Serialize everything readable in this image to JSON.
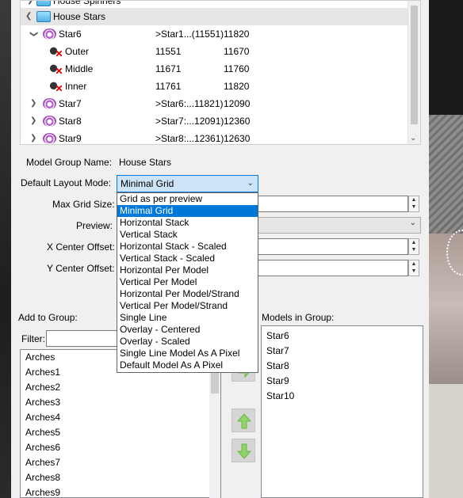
{
  "tree": {
    "rows": [
      {
        "label": "House Spinners",
        "start": "",
        "end": ""
      },
      {
        "label": "House Stars",
        "start": "",
        "end": ""
      },
      {
        "label": "Star6",
        "start": ">Star1...(11551)",
        "end": "11820"
      },
      {
        "label": "Outer",
        "start": "11551",
        "end": "11670"
      },
      {
        "label": "Middle",
        "start": "11671",
        "end": "11760"
      },
      {
        "label": "Inner",
        "start": "11761",
        "end": "11820"
      },
      {
        "label": "Star7",
        "start": ">Star6:...11821)",
        "end": "12090"
      },
      {
        "label": "Star8",
        "start": ">Star7:...12091)",
        "end": "12360"
      },
      {
        "label": "Star9",
        "start": ">Star8:...12361)",
        "end": "12630"
      }
    ]
  },
  "form": {
    "group_name_label": "Model Group Name:",
    "group_name_value": "House Stars",
    "layout_mode_label": "Default Layout Mode:",
    "layout_mode_value": "Minimal Grid",
    "max_grid_label": "Max Grid Size:",
    "preview_label": "Preview:",
    "x_offset_label": "X Center Offset:",
    "y_offset_label": "Y Center Offset:"
  },
  "layout_options": [
    "Grid as per preview",
    "Minimal Grid",
    "Horizontal Stack",
    "Vertical Stack",
    "Horizontal Stack - Scaled",
    "Vertical Stack - Scaled",
    "Horizontal Per Model",
    "Vertical Per Model",
    "Horizontal Per Model/Strand",
    "Vertical Per Model/Strand",
    "Single Line",
    "Overlay - Centered",
    "Overlay - Scaled",
    "Single Line Model As A Pixel",
    "Default Model As A Pixel"
  ],
  "highlighted_option": "Minimal Grid",
  "add_to_group": {
    "label": "Add to Group:",
    "filter_label": "Filter:",
    "items": [
      "Arches",
      "Arches1",
      "Arches2",
      "Arches3",
      "Arches4",
      "Arches5",
      "Arches6",
      "Arches7",
      "Arches8",
      "Arches9"
    ]
  },
  "models_in_group": {
    "label": "Models in Group:",
    "items": [
      "Star6",
      "Star7",
      "Star8",
      "Star9",
      "Star10"
    ]
  },
  "colors": {
    "accent": "#0078d7",
    "select_bg": "#cce4f7",
    "button_arrow": "#8fd36a"
  }
}
